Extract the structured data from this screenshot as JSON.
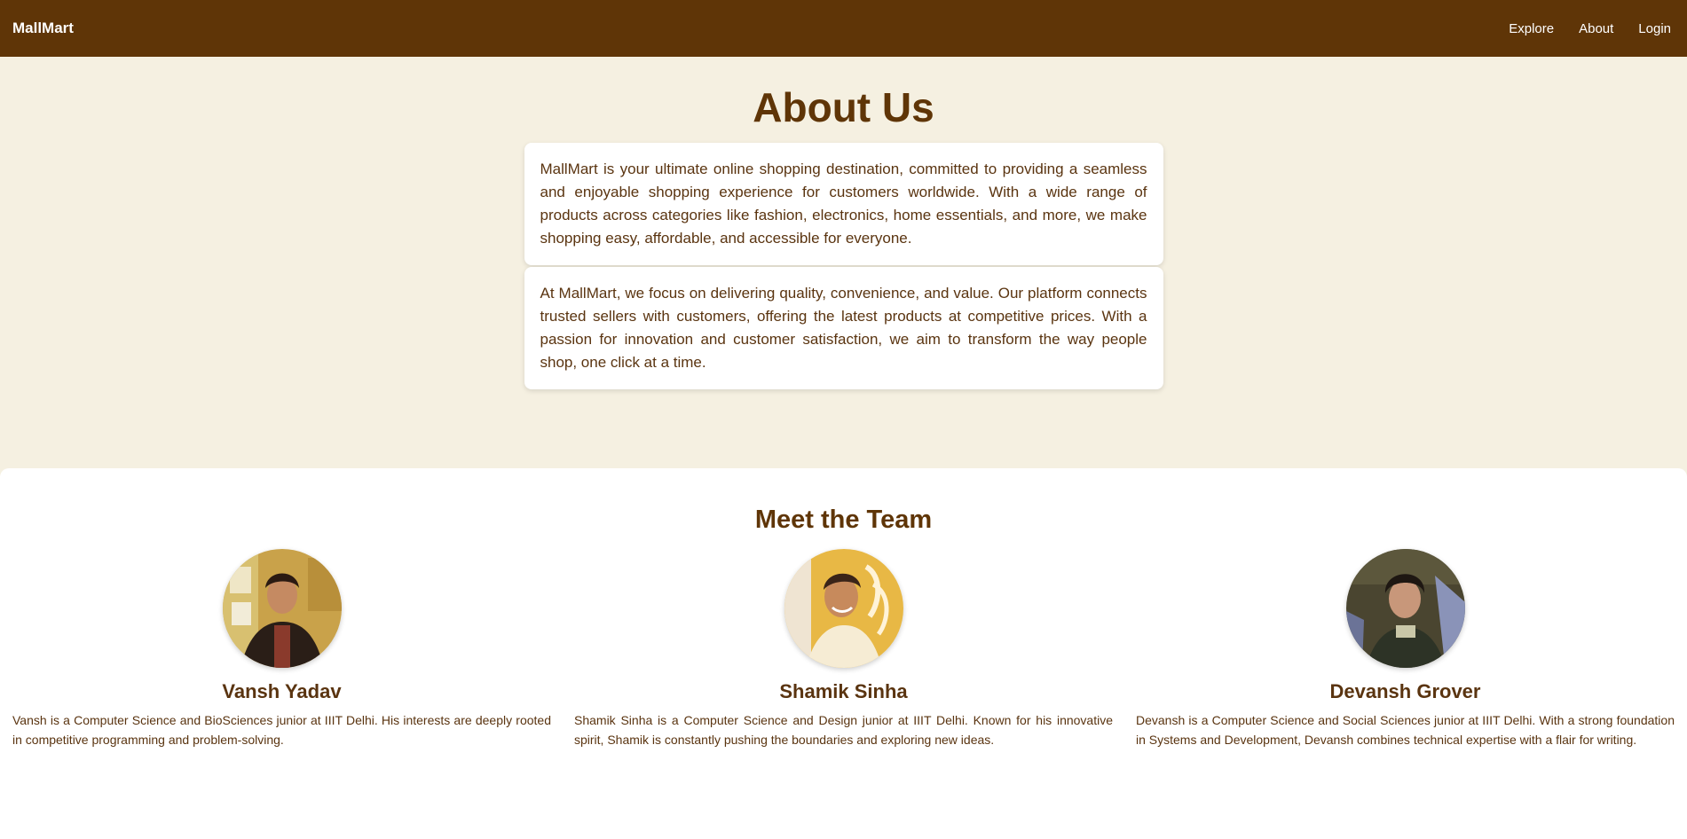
{
  "navbar": {
    "brand": "MallMart",
    "links": [
      "Explore",
      "About",
      "Login"
    ]
  },
  "about": {
    "title": "About Us",
    "paragraphs": [
      "MallMart is your ultimate online shopping destination, committed to providing a seamless and enjoyable shopping experience for customers worldwide. With a wide range of products across categories like fashion, electronics, home essentials, and more, we make shopping easy, affordable, and accessible for everyone.",
      "At MallMart, we focus on delivering quality, convenience, and value. Our platform connects trusted sellers with customers, offering the latest products at competitive prices. With a passion for innovation and customer satisfaction, we aim to transform the way people shop, one click at a time."
    ]
  },
  "team": {
    "title": "Meet the Team",
    "members": [
      {
        "name": "Vansh Yadav",
        "bio": "Vansh is a Computer Science and BioSciences junior at IIIT Delhi. His interests are deeply rooted in competitive programming and problem-solving."
      },
      {
        "name": "Shamik Sinha",
        "bio": "Shamik Sinha is a Computer Science and Design junior at IIIT Delhi. Known for his innovative spirit, Shamik is constantly pushing the boundaries and exploring new ideas."
      },
      {
        "name": "Devansh Grover",
        "bio": "Devansh is a Computer Science and Social Sciences junior at IIIT Delhi. With a strong foundation in Systems and Development, Devansh combines technical expertise with a flair for writing."
      }
    ]
  },
  "colors": {
    "navbar_bg": "#5f3507",
    "page_bg": "#f5f0e1",
    "text_brown": "#5a3410"
  }
}
